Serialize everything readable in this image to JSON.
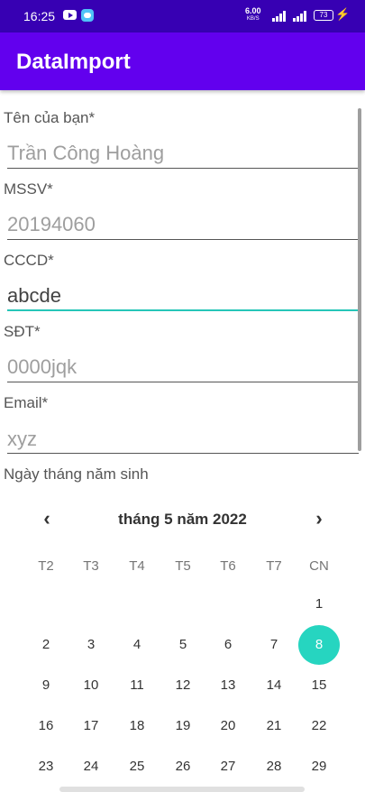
{
  "status_bar": {
    "time": "16:25",
    "net_speed": "6.00",
    "net_unit": "KB/S",
    "battery": "73",
    "icons": [
      "youtube-icon",
      "messenger-icon",
      "signal-icon",
      "battery-icon",
      "charging-icon"
    ]
  },
  "app_bar": {
    "title": "DataImport"
  },
  "form": {
    "fields": [
      {
        "label": "Tên của bạn*",
        "placeholder": "Trần Công Hoàng",
        "value": ""
      },
      {
        "label": "MSSV*",
        "placeholder": "20194060",
        "value": ""
      },
      {
        "label": "CCCD*",
        "placeholder": "",
        "value": "abcde"
      },
      {
        "label": "SĐT*",
        "placeholder": "0000jqk",
        "value": ""
      },
      {
        "label": "Email*",
        "placeholder": "xyz",
        "value": ""
      }
    ],
    "dob_label": "Ngày tháng năm sinh"
  },
  "calendar": {
    "month_label": "tháng 5 năm 2022",
    "prev_icon": "‹",
    "next_icon": "›",
    "weekdays": [
      "T2",
      "T3",
      "T4",
      "T5",
      "T6",
      "T7",
      "CN"
    ],
    "first_weekday_index": 6,
    "days": [
      "1",
      "2",
      "3",
      "4",
      "5",
      "6",
      "7",
      "8",
      "9",
      "10",
      "11",
      "12",
      "13",
      "14",
      "15",
      "16",
      "17",
      "18",
      "19",
      "20",
      "21",
      "22",
      "23",
      "24",
      "25",
      "26",
      "27",
      "28",
      "29"
    ],
    "selected_day": "8",
    "accent": "#26d5c0"
  },
  "colors": {
    "primary": "#6200ee",
    "primary_dark": "#3700b3",
    "focus": "#26c6b8"
  }
}
